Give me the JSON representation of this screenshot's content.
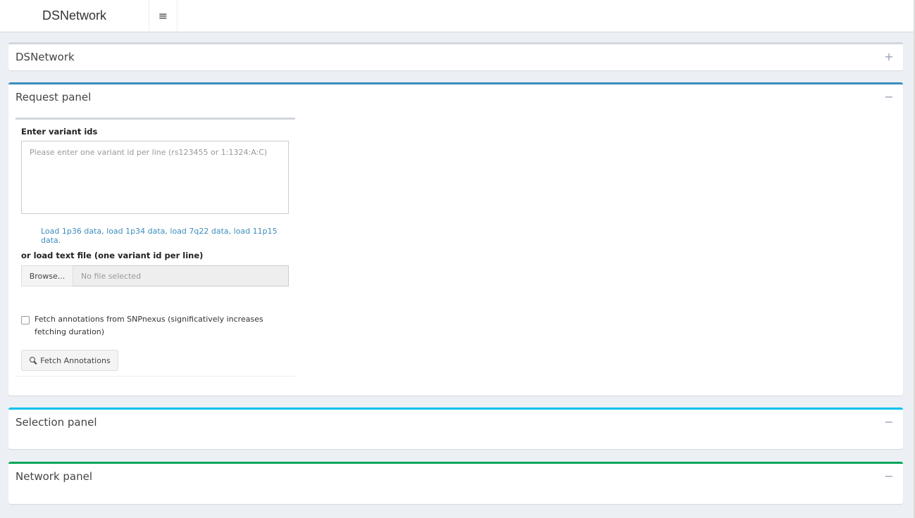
{
  "header": {
    "brand": "DSNetwork",
    "toggle_icon": "≡"
  },
  "panels": {
    "dsnetwork": {
      "title": "DSNetwork",
      "tool": "+"
    },
    "request": {
      "title": "Request panel",
      "tool": "−"
    },
    "selection": {
      "title": "Selection panel",
      "tool": "−"
    },
    "network": {
      "title": "Network panel",
      "tool": "−"
    }
  },
  "request": {
    "variant_label": "Enter variant ids",
    "variant_placeholder": "Please enter one variant id per line (rs123455 or 1:1324:A:C)",
    "load_links": [
      "Load 1p36 data",
      "load 1p34 data",
      "load 7q22 data",
      "load 11p15 data"
    ],
    "file_label": "or load text file (one variant id per line)",
    "browse_label": "Browse...",
    "file_status": "No file selected",
    "checkbox_label": "Fetch annotations from SNPnexus (significatively increases fetching duration)",
    "fetch_button": "Fetch Annotations"
  },
  "colors": {
    "request_accent": "#3c8dbc",
    "selection_accent": "#00c0ef",
    "network_accent": "#00a65a"
  }
}
